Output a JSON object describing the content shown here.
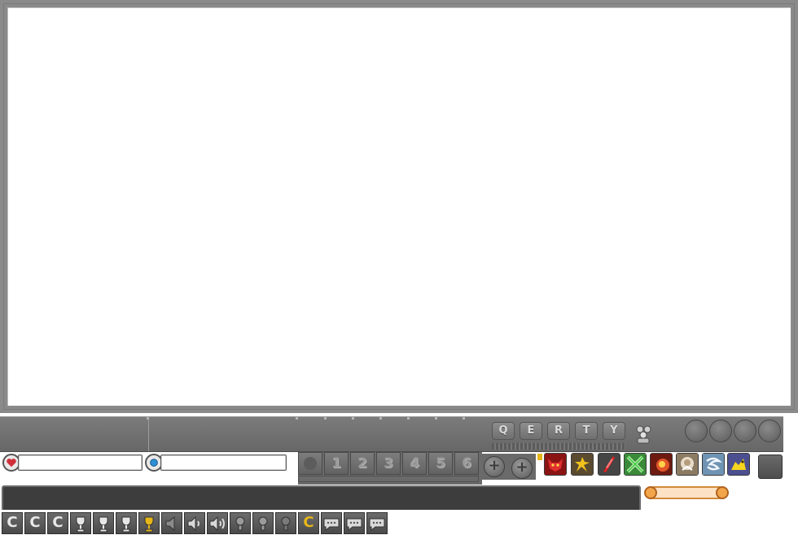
{
  "hotkeys": [
    "Q",
    "E",
    "R",
    "T",
    "Y"
  ],
  "quickslots": [
    "1",
    "2",
    "3",
    "4",
    "5",
    "6"
  ],
  "chat": {
    "value": ""
  },
  "menu": {
    "channel_labels": [
      "C",
      "C",
      "C",
      "C"
    ]
  },
  "colors": {
    "hud": "#6f6f6f",
    "hp_gem": "#d0303c",
    "mp_gem": "#2e8fd3",
    "highlight": "#e6b619",
    "scroll": "#fde2c4"
  },
  "skills": [
    "red-demon-skill-icon",
    "golden-runner-skill-icon",
    "red-claw-skill-icon",
    "green-cross-skill-icon",
    "fire-burst-skill-icon",
    "ghost-aura-skill-icon",
    "wind-spirit-skill-icon",
    "yellow-wolf-skill-icon"
  ]
}
